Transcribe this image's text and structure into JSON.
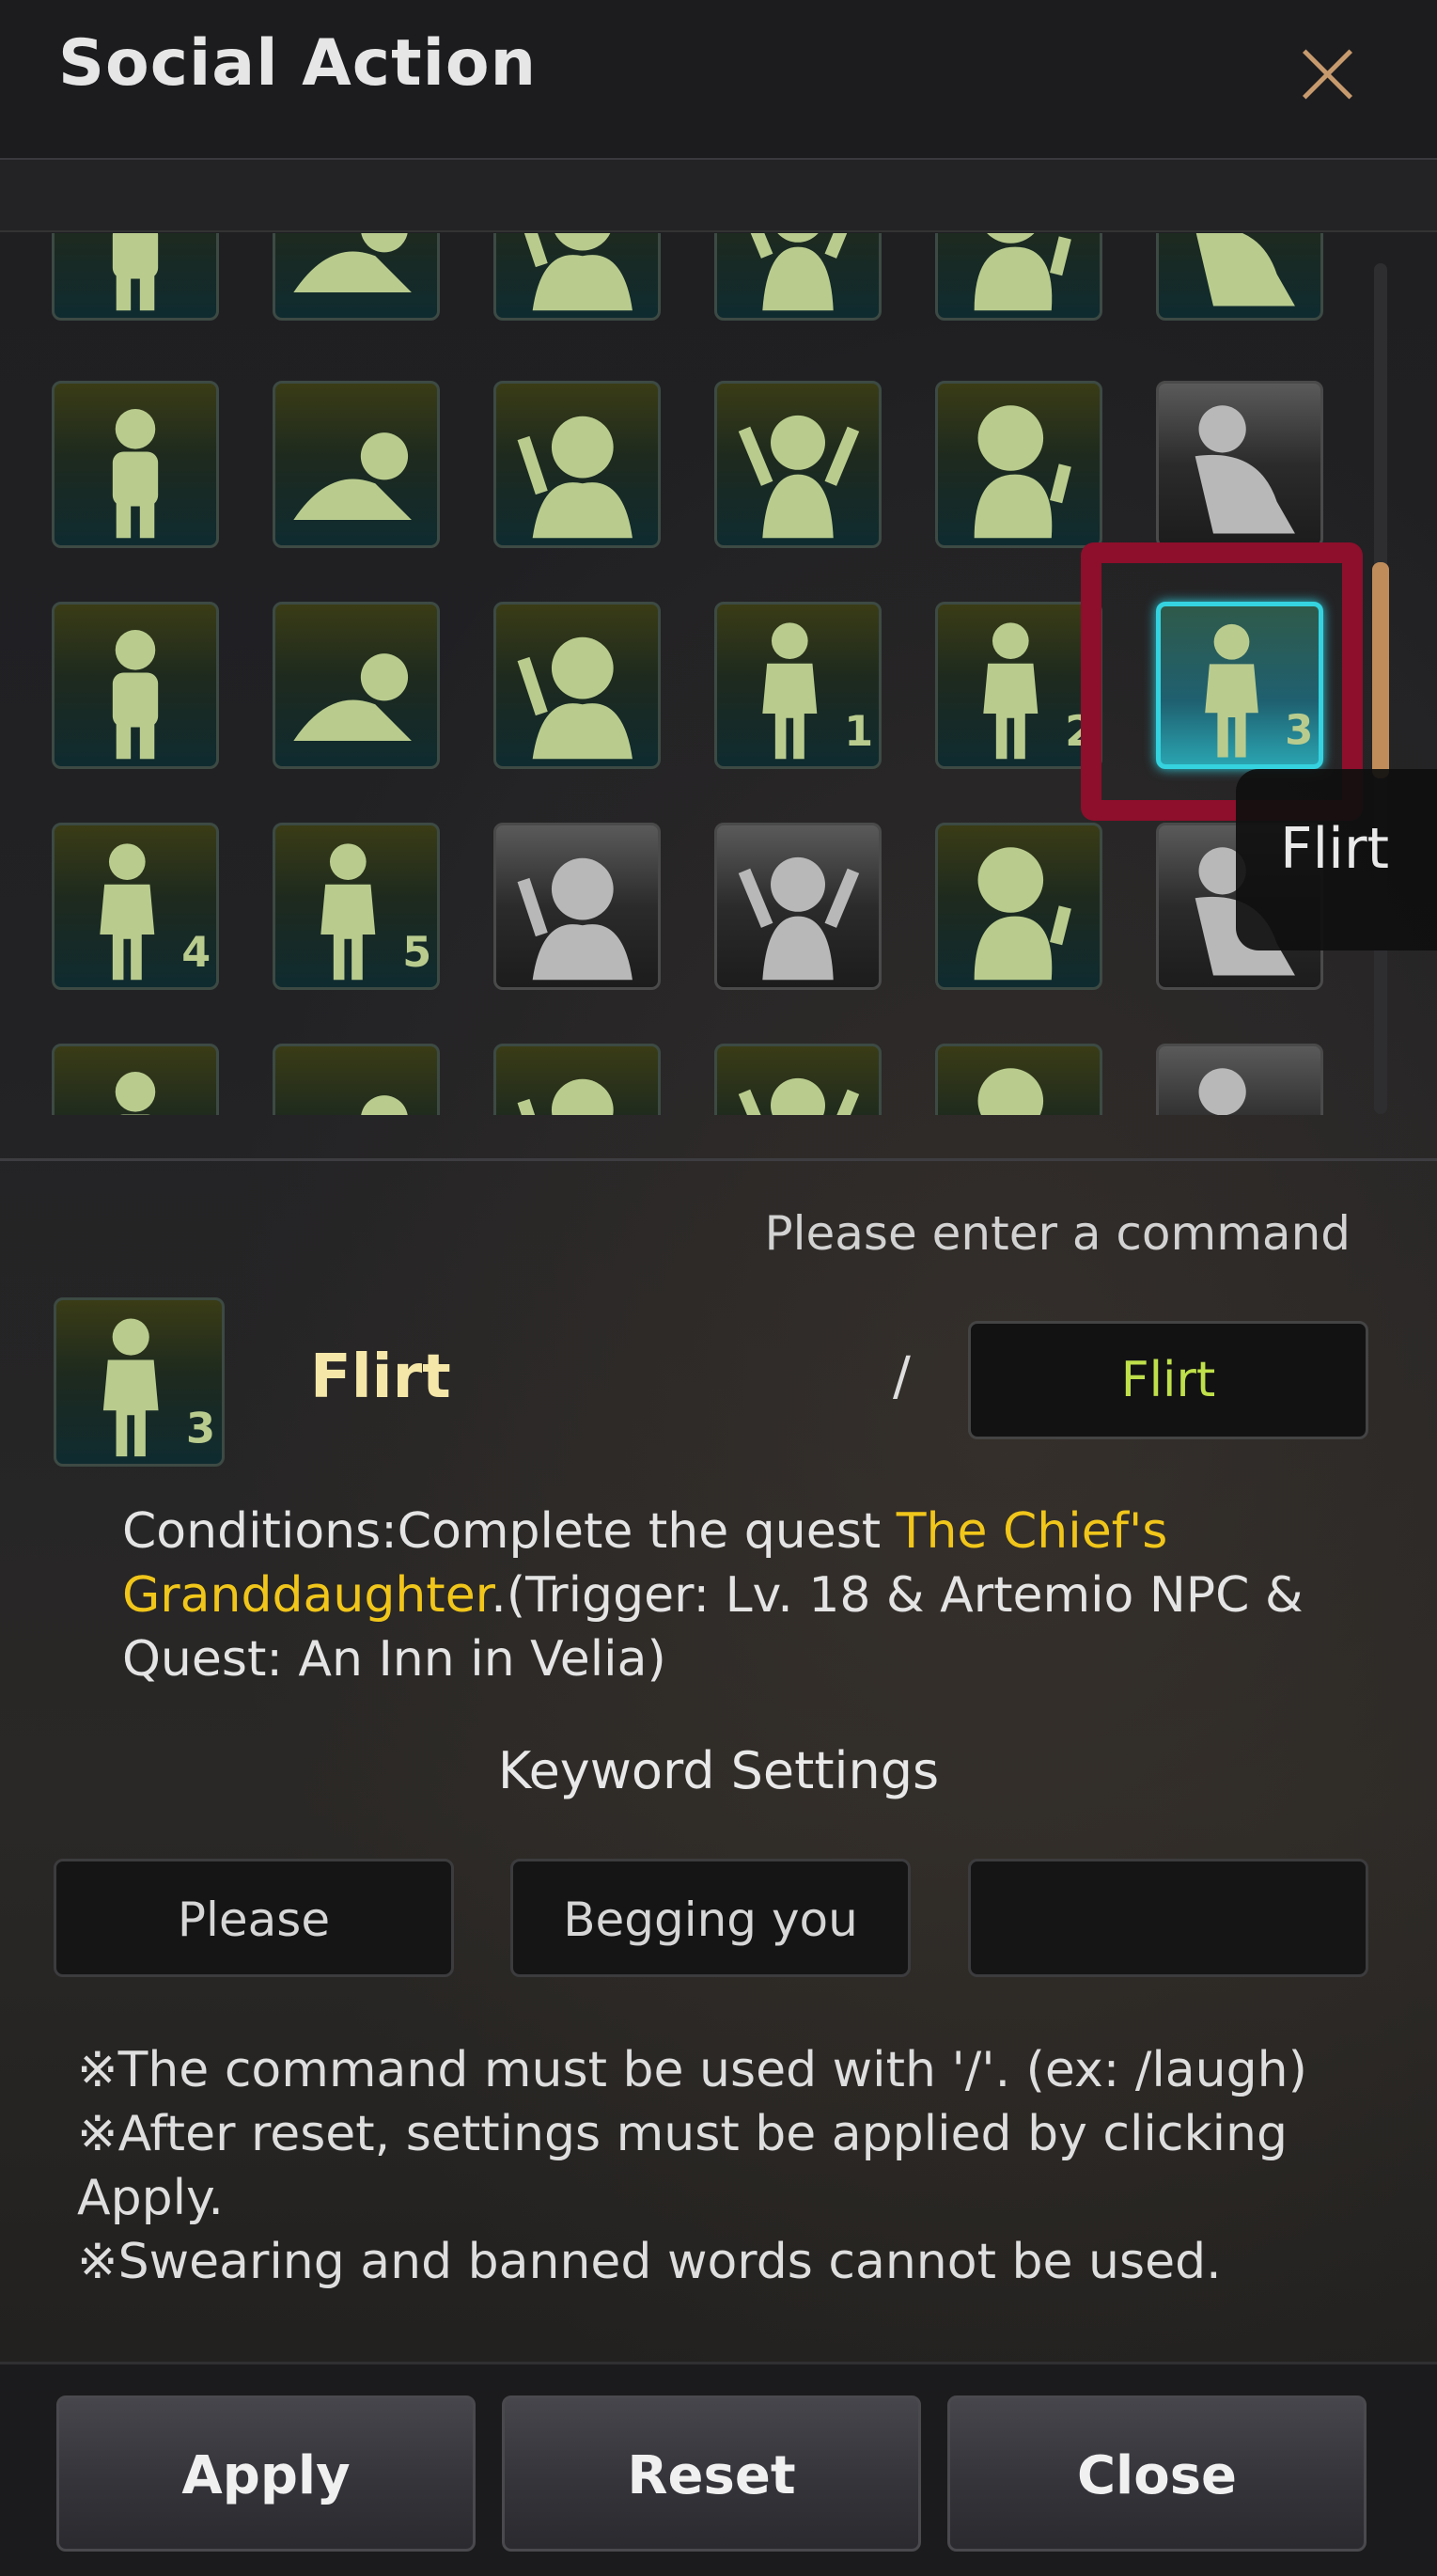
{
  "window": {
    "title": "Social Action",
    "close_icon": "close-x-icon"
  },
  "grid": {
    "icons": [
      "standing-icon",
      "lean-icon",
      "cheer-icon",
      "think-icon",
      "pose-icon",
      "crouch-icon",
      "meditate-icon",
      "lie-down-icon",
      "facepalm-icon",
      "shrug-icon",
      "point-icon",
      "kneel-icon",
      "hooray-icon",
      "angry-icon",
      "stretch-icon",
      "flirt-1-icon",
      "flirt-2-icon",
      "flirt-3-icon",
      "flirt-4-icon",
      "flirt-5-icon",
      "flag-wave-icon",
      "stand-gray-icon",
      "pray-icon",
      "sit-gray-icon",
      "masked-icon",
      "toast-icon",
      "wave-icon",
      "dance-icon",
      "dizzy-icon",
      "surprise-icon"
    ],
    "selected_index": 17,
    "tooltip": "Flirt"
  },
  "detail": {
    "prompt": "Please enter a command",
    "icon_name": "flirt-3-icon",
    "action_name": "Flirt",
    "slash": "/",
    "command": "Flirt",
    "conditions_prefix": "Conditions:Complete the quest ",
    "conditions_quest": "The Chief's Granddaughter",
    "conditions_suffix": ".(Trigger: Lv. 18 & Artemio NPC & Quest: An Inn in Velia)"
  },
  "keywords": {
    "title": "Keyword Settings",
    "values": [
      "Please",
      "Begging you",
      ""
    ]
  },
  "notes": [
    "※The command must be used with '/'. (ex: /laugh)",
    "※After reset, settings must be applied by clicking Apply.",
    "※Swearing and banned words cannot be used."
  ],
  "buttons": {
    "apply": "Apply",
    "reset": "Reset",
    "close": "Close"
  },
  "colors": {
    "accent_highlight": "#8d0f2b",
    "quest_yellow": "#f1c61a",
    "command_green": "#bfe04a",
    "selected_cyan": "#35d3e0"
  }
}
